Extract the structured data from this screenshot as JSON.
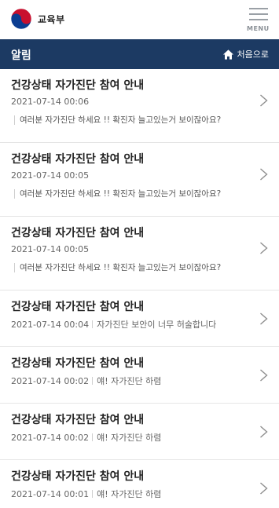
{
  "header": {
    "logo_text": "교육부",
    "menu_label": "MENU"
  },
  "titlebar": {
    "title": "알림",
    "home_label": "처음으로"
  },
  "notifications": [
    {
      "title": "건강상태 자가진단 참여 안내",
      "date": "2021-07-14 00:06",
      "preview": "여러분 자가진단 하세요 !! 확진자 늘고있는거 보이잖아요?"
    },
    {
      "title": "건강상태 자가진단 참여 안내",
      "date": "2021-07-14 00:05",
      "preview": "여러분 자가진단 하세요 !! 확진자 늘고있는거 보이잖아요?"
    },
    {
      "title": "건강상태 자가진단 참여 안내",
      "date": "2021-07-14 00:05",
      "preview": "여러분 자가진단 하세요 !! 확진자 늘고있는거 보이잖아요?"
    },
    {
      "title": "건강상태 자가진단 참여 안내",
      "date": "2021-07-14 00:04",
      "inline": "자가진단 보안이 너무 허술합니다"
    },
    {
      "title": "건강상태 자가진단 참여 안내",
      "date": "2021-07-14 00:02",
      "inline": "얘! 자가진단 하렴"
    },
    {
      "title": "건강상태 자가진단 참여 안내",
      "date": "2021-07-14 00:02",
      "inline": "얘! 자가진단 하렴"
    },
    {
      "title": "건강상태 자가진단 참여 안내",
      "date": "2021-07-14 00:01",
      "inline": "얘! 자가진단 하렴"
    }
  ],
  "colors": {
    "navy": "#1c3a63",
    "taegeuk_red": "#c8102e",
    "taegeuk_blue": "#0b3d91"
  },
  "icons": {
    "logo": "taegeuk-icon",
    "menu": "hamburger-icon",
    "home": "home-icon",
    "row": "chevron-right-icon"
  }
}
